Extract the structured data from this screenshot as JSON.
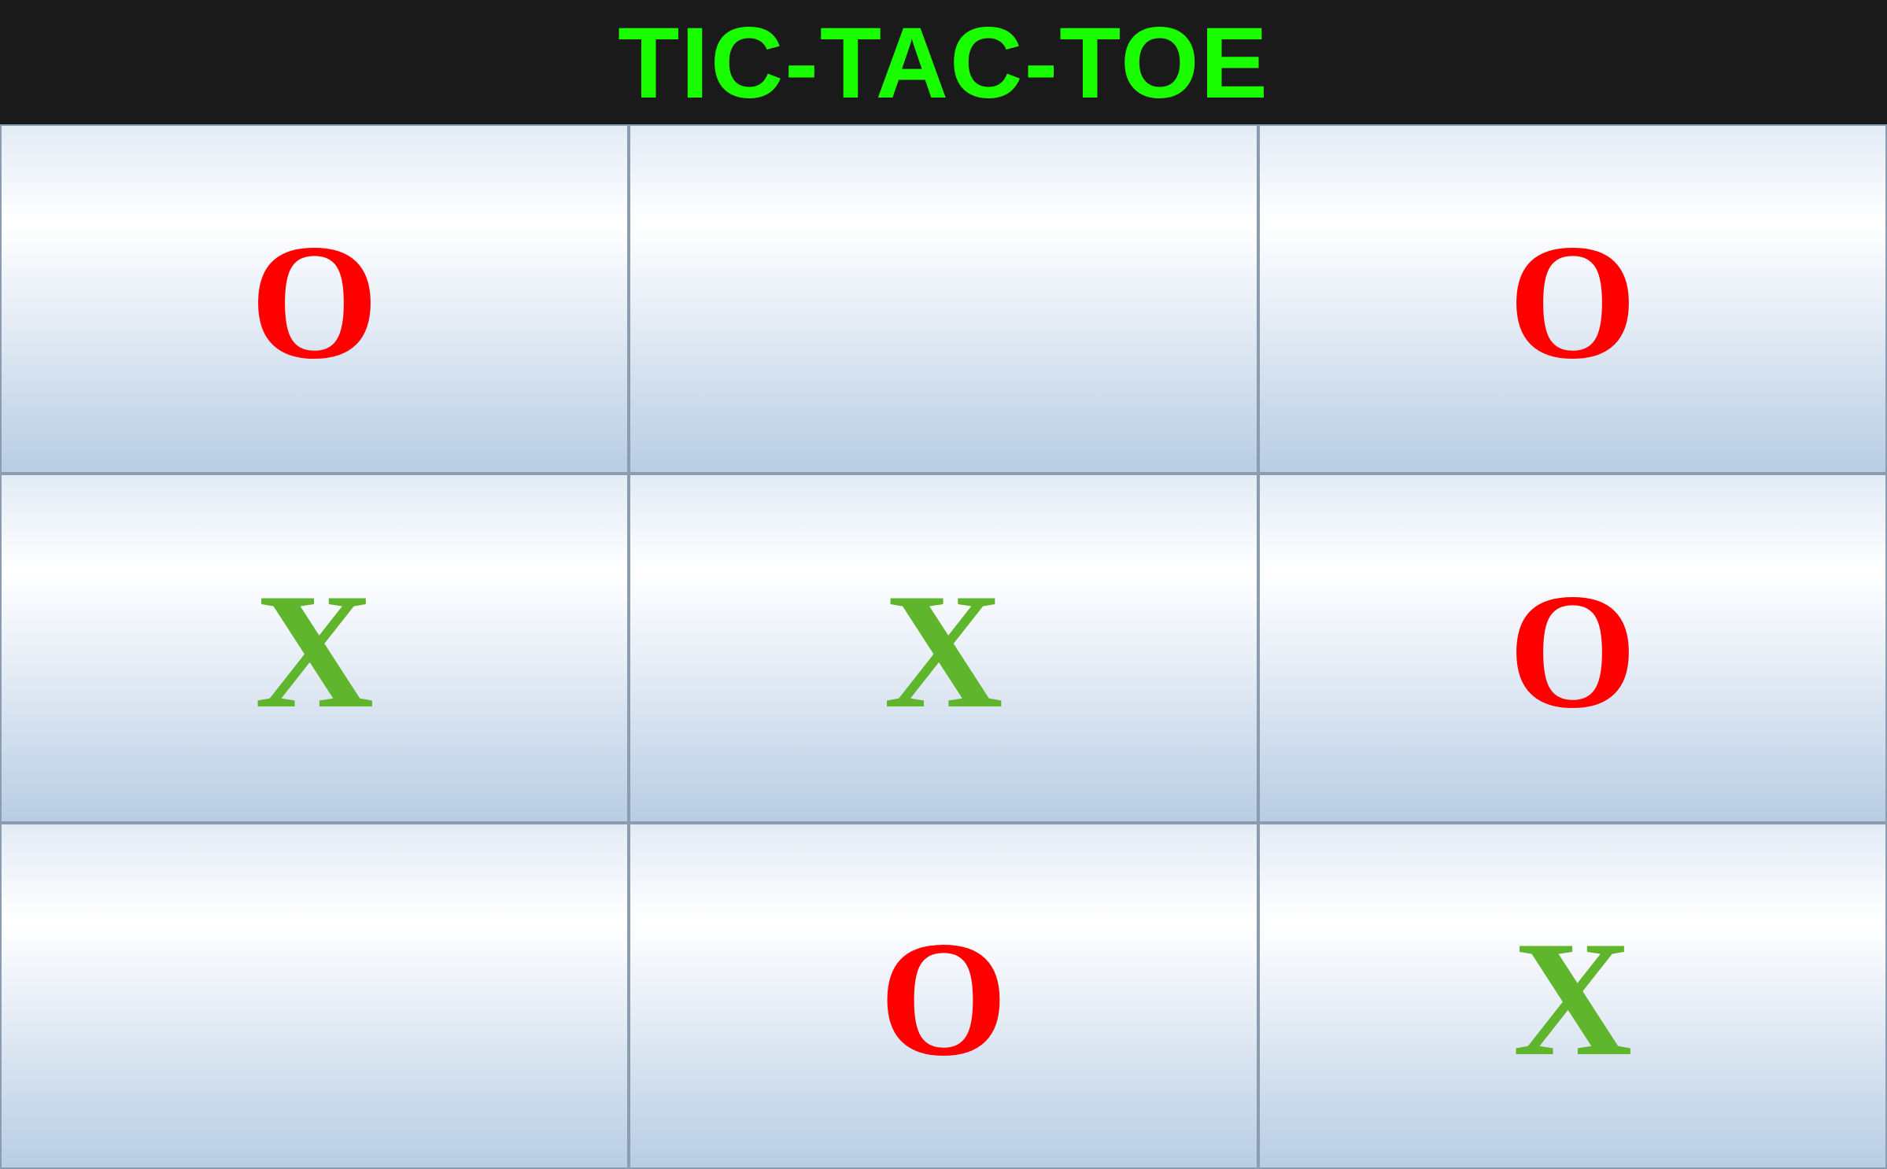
{
  "header": {
    "title": "TIC-TAC-TOE"
  },
  "colors": {
    "title": "#19ff00",
    "x_mark": "#5fb52c",
    "o_mark": "#ff0000",
    "header_bg": "#1a1a1a",
    "grid_line": "#8b9bb0"
  },
  "board": {
    "cells": [
      {
        "row": 1,
        "col": 1,
        "mark": "O"
      },
      {
        "row": 1,
        "col": 2,
        "mark": ""
      },
      {
        "row": 1,
        "col": 3,
        "mark": "O"
      },
      {
        "row": 2,
        "col": 1,
        "mark": "X"
      },
      {
        "row": 2,
        "col": 2,
        "mark": "X"
      },
      {
        "row": 2,
        "col": 3,
        "mark": "O"
      },
      {
        "row": 3,
        "col": 1,
        "mark": ""
      },
      {
        "row": 3,
        "col": 2,
        "mark": "O"
      },
      {
        "row": 3,
        "col": 3,
        "mark": "X"
      }
    ]
  }
}
